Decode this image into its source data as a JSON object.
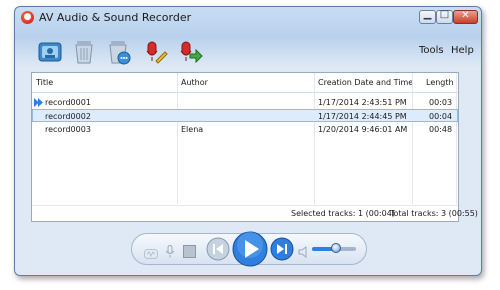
{
  "window": {
    "title": "AV Audio & Sound Recorder"
  },
  "toolbar": {
    "buttons": [
      {
        "name": "recorder-settings-button",
        "icon": "recorder-profile-icon"
      },
      {
        "name": "delete-button",
        "icon": "trash-icon"
      },
      {
        "name": "delete-all-button",
        "icon": "trash-with-dots-icon"
      },
      {
        "name": "edit-track-button",
        "icon": "microphone-pencil-icon"
      },
      {
        "name": "export-track-button",
        "icon": "microphone-arrow-icon"
      }
    ],
    "menu": {
      "tools": "Tools",
      "help": "Help"
    }
  },
  "table": {
    "columns": [
      "Title",
      "Author",
      "Creation Date and Time",
      "Length"
    ],
    "rows": [
      {
        "title": "record0001",
        "author": "",
        "created": "1/17/2014 2:43:51 PM",
        "length": "00:03",
        "playing": true,
        "selected": false
      },
      {
        "title": "record0002",
        "author": "",
        "created": "1/17/2014 2:44:45 PM",
        "length": "00:04",
        "playing": false,
        "selected": true
      },
      {
        "title": "record0003",
        "author": "Elena",
        "created": "1/20/2014 9:46:01 AM",
        "length": "00:48",
        "playing": false,
        "selected": false
      }
    ]
  },
  "status": {
    "selected": "Selected tracks: 1 (00:04)",
    "total": "Total tracks: 3 (00:55)"
  },
  "player": {
    "volume_level": 0.55,
    "colors": {
      "accent": "#2f7fe0"
    }
  }
}
